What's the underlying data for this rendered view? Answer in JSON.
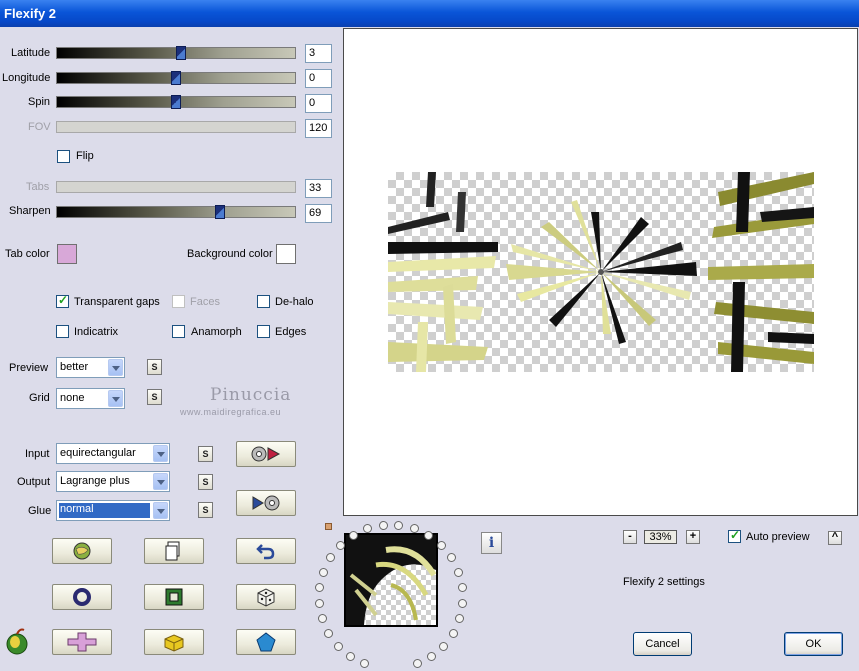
{
  "window": {
    "title": "Flexify 2"
  },
  "sliders": [
    {
      "label": "Latitude",
      "value": "3",
      "position": 0.52,
      "enabled": true
    },
    {
      "label": "Longitude",
      "value": "0",
      "position": 0.5,
      "enabled": true
    },
    {
      "label": "Spin",
      "value": "0",
      "position": 0.5,
      "enabled": true
    },
    {
      "label": "FOV",
      "value": "120",
      "enabled": false
    },
    {
      "label": "Tabs",
      "value": "33",
      "enabled": false
    },
    {
      "label": "Sharpen",
      "value": "69",
      "position": 0.69,
      "enabled": true
    }
  ],
  "flip": {
    "label": "Flip",
    "checked": false
  },
  "colors": {
    "tab_label": "Tab color",
    "tab_color": "#d8a8d8",
    "background_label": "Background color",
    "background_color": "#ffffff"
  },
  "options": [
    {
      "label": "Transparent gaps",
      "checked": true,
      "enabled": true
    },
    {
      "label": "Faces",
      "checked": false,
      "enabled": false
    },
    {
      "label": "De-halo",
      "checked": false,
      "enabled": true
    },
    {
      "label": "Indicatrix",
      "checked": false,
      "enabled": true
    },
    {
      "label": "Anamorph",
      "checked": false,
      "enabled": true
    },
    {
      "label": "Edges",
      "checked": false,
      "enabled": true
    }
  ],
  "preview_quality": {
    "label": "Preview",
    "value": "better"
  },
  "grid": {
    "label": "Grid",
    "value": "none"
  },
  "small_button_label": "S",
  "watermark": {
    "line1": "Pinuccia",
    "line2": "www.maidiregrafica.eu"
  },
  "input": {
    "label": "Input",
    "value": "equirectangular"
  },
  "output": {
    "label": "Output",
    "value": "Lagrange plus"
  },
  "glue": {
    "label": "Glue",
    "value": "normal"
  },
  "zoom": {
    "value": "33%",
    "minus": "-",
    "plus": "+"
  },
  "auto_preview": {
    "label": "Auto preview",
    "checked": true
  },
  "collapse_label": "^",
  "settings_label": "Flexify 2 settings",
  "info_label": "i",
  "buttons": {
    "cancel": "Cancel",
    "ok": "OK"
  }
}
